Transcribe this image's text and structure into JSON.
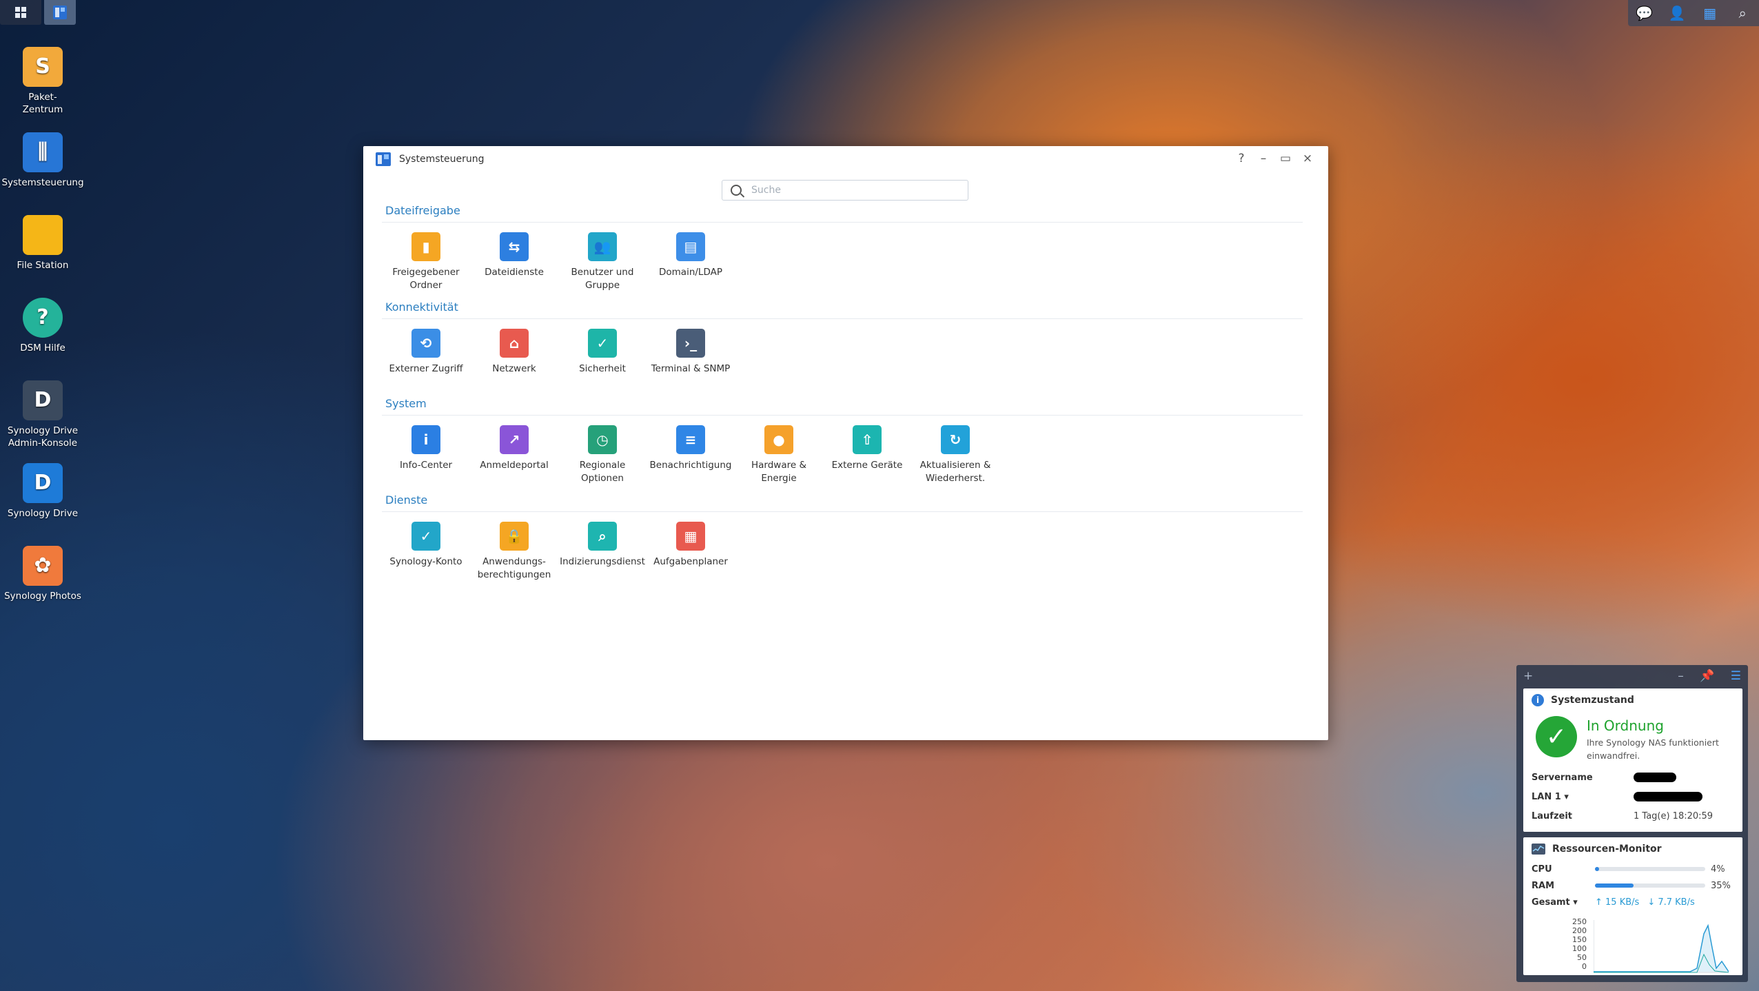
{
  "taskbar": {
    "left": [
      "apps-grid-icon",
      "control-panel-task-icon"
    ],
    "right_icons": [
      "chat-notification-icon",
      "user-icon",
      "widgets-icon",
      "search-icon"
    ]
  },
  "desktop": {
    "icons": [
      {
        "name": "package-center",
        "label": "Paket-\nZentrum",
        "icon": "package-icon",
        "color": "#f2a93b"
      },
      {
        "name": "control-panel",
        "label": "Systemsteuerung",
        "icon": "sliders-icon",
        "color": "#2776d6"
      },
      {
        "name": "file-station",
        "label": "File Station",
        "icon": "folder-icon",
        "color": "#f5b617"
      },
      {
        "name": "dsm-help",
        "label": "DSM Hilfe",
        "icon": "help-icon",
        "color": "#24b39a"
      },
      {
        "name": "drive-admin",
        "label": "Synology Drive\nAdmin-Konsole",
        "icon": "drive-admin-icon",
        "color": "#3b4a5e"
      },
      {
        "name": "synology-drive",
        "label": "Synology Drive",
        "icon": "drive-icon",
        "color": "#1e7bd8"
      },
      {
        "name": "synology-photos",
        "label": "Synology Photos",
        "icon": "photos-icon",
        "color": "#f07a3c"
      }
    ]
  },
  "window": {
    "title": "Systemsteuerung",
    "controls": [
      "?",
      "–",
      "▭",
      "×"
    ],
    "search_placeholder": "Suche",
    "sections": [
      {
        "title": "Dateifreigabe",
        "items": [
          {
            "label": "Freigegebener\nOrdner",
            "icon": "shared-folder-icon",
            "color": "#f5a623"
          },
          {
            "label": "Dateidienste",
            "icon": "file-services-icon",
            "color": "#2d7fe0"
          },
          {
            "label": "Benutzer und\nGruppe",
            "icon": "users-icon",
            "color": "#22a6c9"
          },
          {
            "label": "Domain/LDAP",
            "icon": "domain-icon",
            "color": "#3d8ee8"
          }
        ]
      },
      {
        "title": "Konnektivität",
        "items": [
          {
            "label": "Externer Zugriff",
            "icon": "external-access-icon",
            "color": "#3b8ee6"
          },
          {
            "label": "Netzwerk",
            "icon": "network-icon",
            "color": "#e85a4f"
          },
          {
            "label": "Sicherheit",
            "icon": "security-icon",
            "color": "#1eb5a8"
          },
          {
            "label": "Terminal & SNMP",
            "icon": "terminal-icon",
            "color": "#4a5d78"
          }
        ]
      },
      {
        "title": "System",
        "items": [
          {
            "label": "Info-Center",
            "icon": "info-icon",
            "color": "#2b7fe3"
          },
          {
            "label": "Anmeldeportal",
            "icon": "login-portal-icon",
            "color": "#8a55d8"
          },
          {
            "label": "Regionale\nOptionen",
            "icon": "regional-icon",
            "color": "#26a17a"
          },
          {
            "label": "Benachrichtigung",
            "icon": "notification-icon",
            "color": "#2f86e6"
          },
          {
            "label": "Hardware &\nEnergie",
            "icon": "hardware-icon",
            "color": "#f5a12b"
          },
          {
            "label": "Externe Geräte",
            "icon": "external-devices-icon",
            "color": "#1cb5b0"
          },
          {
            "label": "Aktualisieren &\nWiederherst.",
            "icon": "update-icon",
            "color": "#22a2d9"
          }
        ]
      },
      {
        "title": "Dienste",
        "items": [
          {
            "label": "Synology-Konto",
            "icon": "synology-account-icon",
            "color": "#22a6c9"
          },
          {
            "label": "Anwendungs-\nberechtigungen",
            "icon": "lock-icon",
            "color": "#f5a623"
          },
          {
            "label": "Indizierungsdienst",
            "icon": "index-icon",
            "color": "#1eb5b0"
          },
          {
            "label": "Aufgabenplaner",
            "icon": "task-scheduler-icon",
            "color": "#e85a4f"
          }
        ]
      }
    ]
  },
  "widgets": {
    "health": {
      "title": "Systemzustand",
      "status": "In Ordnung",
      "description": "Ihre Synology NAS funktioniert einwandfrei.",
      "rows": [
        {
          "label": "Servername",
          "value": ""
        },
        {
          "label": "LAN 1 ▾",
          "value": ""
        },
        {
          "label": "Laufzeit",
          "value": "1 Tag(e) 18:20:59"
        }
      ]
    },
    "resources": {
      "title": "Ressourcen-Monitor",
      "cpu_label": "CPU",
      "cpu_pct": 4,
      "cpu_text": "4%",
      "ram_label": "RAM",
      "ram_pct": 35,
      "ram_text": "35%",
      "net_label": "Gesamt ▾",
      "upload": "15 KB/s",
      "download": "7.7 KB/s",
      "y_ticks": [
        "250",
        "200",
        "150",
        "100",
        "50",
        "0"
      ]
    }
  }
}
